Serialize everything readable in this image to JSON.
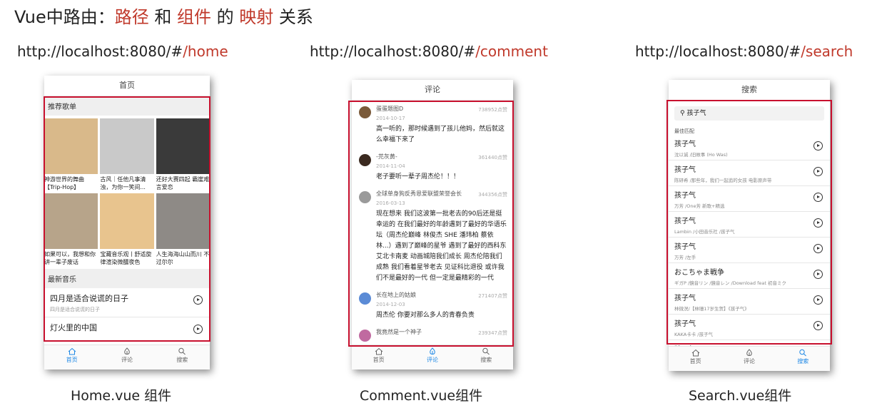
{
  "heading": {
    "prefix": "Vue中路由：",
    "path": "路径",
    "and": " 和 ",
    "component": "组件",
    "de": " 的 ",
    "mapping": "映射",
    "suffix": " 关系"
  },
  "panels": [
    {
      "url_base": "http://localhost:8080/#",
      "url_route": "/home",
      "caption": "Home.vue 组件"
    },
    {
      "url_base": "http://localhost:8080/#",
      "url_route": "/comment",
      "caption": "Comment.vue组件"
    },
    {
      "url_base": "http://localhost:8080/#",
      "url_route": "/search",
      "caption": "Search.vue组件"
    }
  ],
  "tabs": [
    "首页",
    "评论",
    "搜索"
  ],
  "home": {
    "header": "首页",
    "section_recommend": "推荐歌单",
    "playlists": [
      {
        "name": "神游世界的舞曲【Trip-Hop】",
        "color": "#d9b98a"
      },
      {
        "name": "古风｜任他凡事清浊，为你一笑间...",
        "color": "#c9c9c9"
      },
      {
        "name": "还好大赛四起 霸崖难言爱恋",
        "color": "#3a3a3a"
      },
      {
        "name": "如果可以，我想和你讲一辈子废话",
        "color": "#b7a48a"
      },
      {
        "name": "宝藏音乐观丨舒适旋律渲染微醺夜色",
        "color": "#e8c48e"
      },
      {
        "name": "人生海海山山而川 不过尔尔",
        "color": "#8e8a86"
      }
    ],
    "section_new": "最新音乐",
    "songs": [
      {
        "title": "四月是适合说谎的日子",
        "sub": "四月是适合说谎的日子"
      },
      {
        "title": "灯火里的中国",
        "sub": ""
      }
    ]
  },
  "comment": {
    "header": "评论",
    "items": [
      {
        "nick": "蛋蛋题图D",
        "likes": "738952点赞",
        "date": "2014-10-17",
        "text": "高一听的，那时候遇到了孩儿他妈，然后就这么幸福下来了",
        "avatar": "#7a5a3a"
      },
      {
        "nick": "-芫灰黄-",
        "likes": "361440点赞",
        "date": "2014-11-04",
        "text": "老子要听一辈子周杰伦！！！",
        "avatar": "#3b2a20"
      },
      {
        "nick": "全球单身狗反秀恩爱联盟荣誉会长",
        "likes": "344356点赞",
        "date": "2016-03-13",
        "text": "现在想来 我们这波第一批老去的90后还是挺幸运的 在我们最好的年龄遇到了最好的华语乐坛（周杰伦巅峰 林俊杰 SHE 潘玮柏 蔡依林...）遇到了巅峰的星爷 遇到了最好的西科东艾北卡南麦 动画城陪我们成长 周杰伦陪我们成熟 我们看着星爷老去 见证科比退役 或许我们不是最好的一代 但一定是最精彩的一代",
        "avatar": "#9a9a9a"
      },
      {
        "nick": "长在地上的姑娘",
        "likes": "271407点赞",
        "date": "2014-12-03",
        "text": "周杰伦 你要对那么多人的青春负责",
        "avatar": "#5b8bd6"
      },
      {
        "nick": "我竟然是一个神子",
        "likes": "239347点赞",
        "date": "",
        "text": "",
        "avatar": "#c06aa0"
      }
    ]
  },
  "search": {
    "header": "搜索",
    "query": "孩子气",
    "best_label": "最佳匹配",
    "results": [
      {
        "title": "孩子气",
        "sub": "沈以诚 /旧故事 (Ho Was)"
      },
      {
        "title": "孩子气",
        "sub": "陈研希 /那些年，我们一起追的女孩 电影原声带"
      },
      {
        "title": "孩子气",
        "sub": "万芳 /One芳 新歌+精选"
      },
      {
        "title": "孩子气",
        "sub": "Lambin /小田音乐社 /孩子气"
      },
      {
        "title": "孩子气",
        "sub": "万芳 /左手"
      },
      {
        "title": "おこちゃま戦争",
        "sub": "ギガP /鏡音リン /鏡音レン /Download feat 初音ミク"
      },
      {
        "title": "孩子气",
        "sub": "林微溟/【林珊17岁生贺】《孩子气》"
      },
      {
        "title": "孩子气",
        "sub": "KAKA卡卡 /孩子气"
      },
      {
        "title": "孩子气",
        "sub": ""
      }
    ]
  }
}
